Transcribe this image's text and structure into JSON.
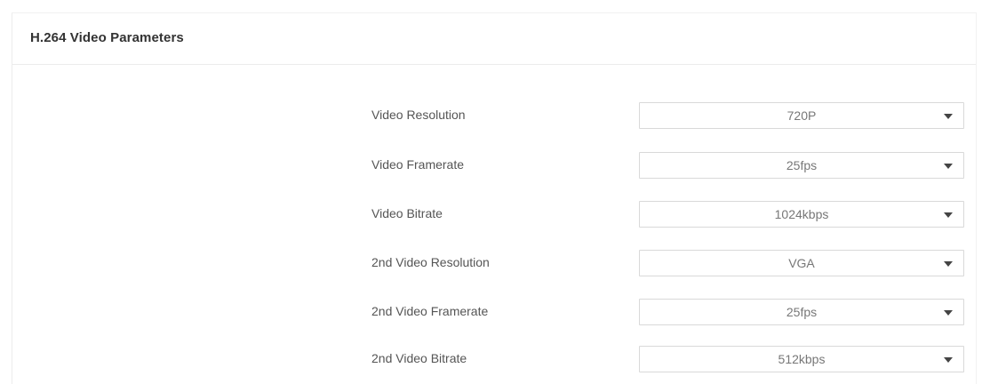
{
  "panel": {
    "title": "H.264 Video Parameters"
  },
  "fields": [
    {
      "label": "Video Resolution",
      "value": "720P"
    },
    {
      "label": "Video Framerate",
      "value": "25fps"
    },
    {
      "label": "Video Bitrate",
      "value": "1024kbps"
    },
    {
      "label": "2nd Video Resolution",
      "value": "VGA"
    },
    {
      "label": "2nd Video Framerate",
      "value": "25fps"
    },
    {
      "label": "2nd Video Bitrate",
      "value": "512kbps"
    }
  ],
  "icons": {
    "dropdown": "triangle-down-icon"
  }
}
